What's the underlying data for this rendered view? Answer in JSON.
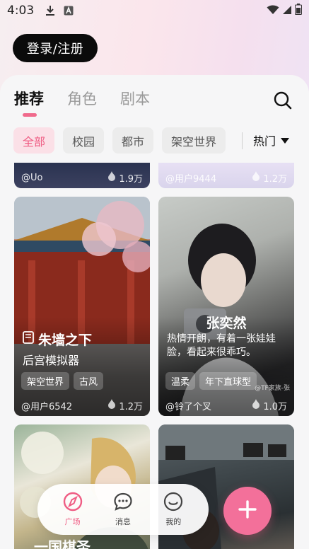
{
  "status_bar": {
    "time": "4:03"
  },
  "header": {
    "login_label": "登录/注册"
  },
  "tabs": [
    {
      "label": "推荐",
      "active": true
    },
    {
      "label": "角色",
      "active": false
    },
    {
      "label": "剧本",
      "active": false
    }
  ],
  "filters": [
    {
      "label": "全部",
      "active": true
    },
    {
      "label": "校园",
      "active": false
    },
    {
      "label": "都市",
      "active": false
    },
    {
      "label": "架空世界",
      "active": false
    }
  ],
  "sort": {
    "label": "热门"
  },
  "cards": {
    "top_left": {
      "author": "@Uo",
      "likes": "1.9万"
    },
    "top_right": {
      "author": "@用户9444",
      "likes": "1.2万"
    },
    "palace": {
      "title": "朱墙之下",
      "subtitle": "后宫模拟器",
      "tags": [
        "架空世界",
        "古风"
      ],
      "author": "@用户6542",
      "likes": "1.2万"
    },
    "portrait": {
      "name": "张奕然",
      "description": "热情开朗，有着一张娃娃脸，看起来很乖巧。",
      "tags": [
        "温柔",
        "年下直球型"
      ],
      "author": "@铃了个叉",
      "likes": "1.0万",
      "watermark": "@TF家族-张"
    },
    "anime": {
      "title": "一国棋圣"
    },
    "gym": {}
  },
  "bottom_nav": [
    {
      "label": "广场",
      "icon": "compass-icon",
      "active": true
    },
    {
      "label": "消息",
      "icon": "chat-icon",
      "active": false
    },
    {
      "label": "我的",
      "icon": "smile-icon",
      "active": false
    }
  ],
  "colors": {
    "accent": "#ef5d84",
    "fab": "#f3709a",
    "login_bg": "#0b0b0b"
  }
}
